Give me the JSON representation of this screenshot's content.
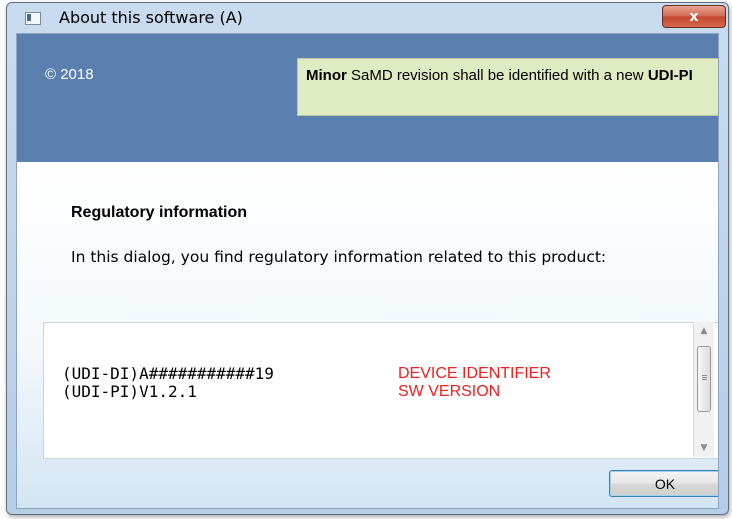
{
  "window": {
    "title": "About this software (A)",
    "close_label": "x"
  },
  "header": {
    "copyright": "© 2018",
    "note": {
      "part1_bold": "Minor",
      "part2": " SaMD revision shall be identified with a new ",
      "part3_bold": "UDI-PI"
    }
  },
  "regulatory": {
    "heading": "Regulatory information",
    "description": "In this dialog, you find regulatory information related to this product:"
  },
  "info_rows": [
    {
      "value": "(UDI-DI)A###########19",
      "label": "DEVICE IDENTIFIER"
    },
    {
      "value": "(UDI-PI)V1.2.1",
      "label": "SW VERSION"
    }
  ],
  "buttons": {
    "ok": "OK"
  },
  "colors": {
    "header_band": "#5b80b0",
    "note_bg": "#dfebc3",
    "label_red": "#f02020"
  }
}
